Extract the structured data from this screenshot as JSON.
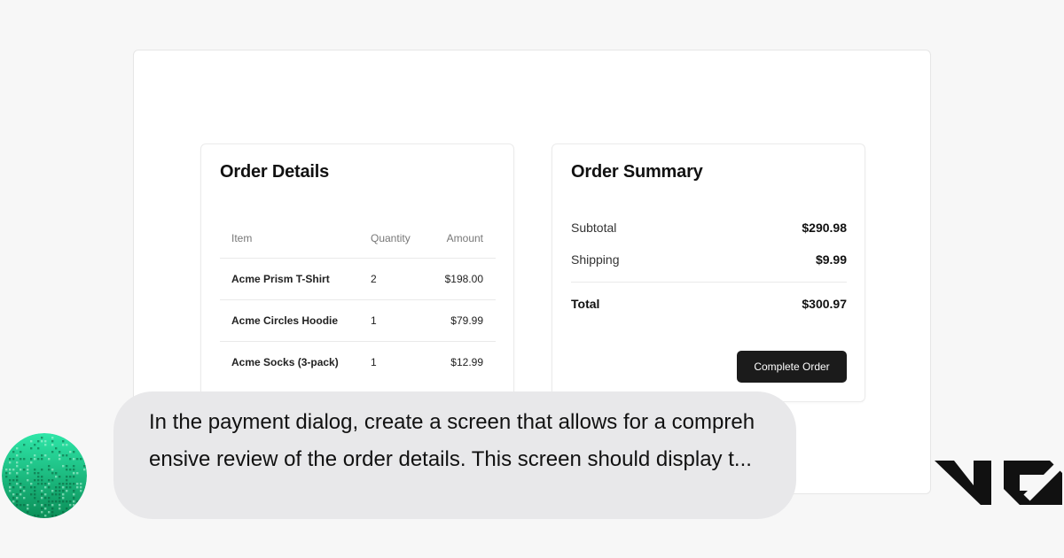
{
  "order_details": {
    "title": "Order Details",
    "columns": {
      "item": "Item",
      "quantity": "Quantity",
      "amount": "Amount"
    },
    "rows": [
      {
        "item": "Acme Prism T-Shirt",
        "quantity": "2",
        "amount": "$198.00"
      },
      {
        "item": "Acme Circles Hoodie",
        "quantity": "1",
        "amount": "$79.99"
      },
      {
        "item": "Acme Socks (3-pack)",
        "quantity": "1",
        "amount": "$12.99"
      }
    ]
  },
  "order_summary": {
    "title": "Order Summary",
    "subtotal_label": "Subtotal",
    "subtotal_value": "$290.98",
    "shipping_label": "Shipping",
    "shipping_value": "$9.99",
    "total_label": "Total",
    "total_value": "$300.97",
    "button_label": "Complete Order"
  },
  "chat": {
    "message": "In the payment dialog, create a screen that allows for a comprehensive review of the order details. This screen should display t..."
  },
  "colors": {
    "page_bg": "#f7f7f7",
    "bubble_bg": "#e8e8ea",
    "button_bg": "#1b1b1b",
    "avatar_green": "#19d68f",
    "logo": "#111111"
  },
  "icons": {
    "avatar": "pixel-gradient-avatar-icon",
    "logo": "v0-logo-icon"
  }
}
